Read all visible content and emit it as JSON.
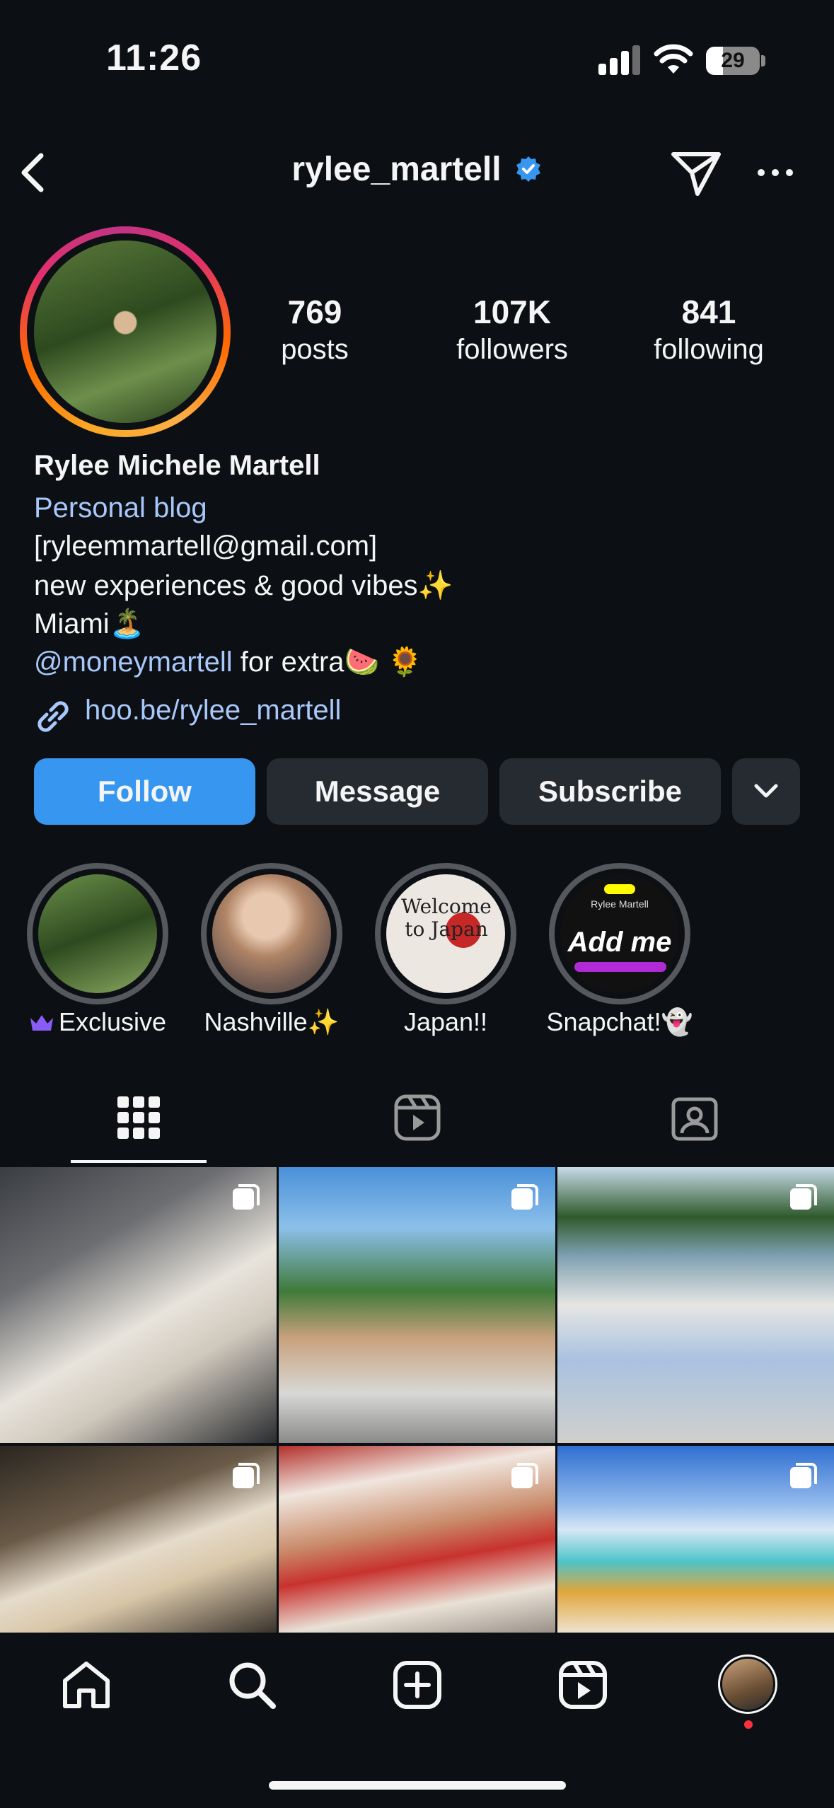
{
  "status_bar": {
    "time": "11:26",
    "battery": "29"
  },
  "header": {
    "username": "rylee_martell"
  },
  "stats": [
    {
      "value": "769",
      "label": "posts"
    },
    {
      "value": "107K",
      "label": "followers"
    },
    {
      "value": "841",
      "label": "following"
    }
  ],
  "bio": {
    "name": "Rylee Michele Martell",
    "category": "Personal blog",
    "email": "[ryleemmartell@gmail.com]",
    "line1": "new experiences & good vibes✨",
    "line2": "Miami🏝️",
    "mention": "@moneymartell",
    "line3_rest": " for extra🍉 🌻",
    "link": "hoo.be/rylee_martell"
  },
  "actions": {
    "follow": "Follow",
    "message": "Message",
    "subscribe": "Subscribe"
  },
  "highlights": [
    {
      "label": "Exclusive",
      "icon": "crown-icon"
    },
    {
      "label": "Nashville✨"
    },
    {
      "label": "Japan!!",
      "cover_text": "Welcome to Japan"
    },
    {
      "label": "Snapchat!👻",
      "cover_text": "Add me",
      "cover_subtext": "Rylee Martell"
    }
  ],
  "tabs": [
    "grid-icon",
    "reels-icon",
    "tagged-icon"
  ],
  "colors": {
    "accent": "#3797f0",
    "link": "#a8c7fa",
    "background": "#0c1014",
    "button": "#262b31"
  }
}
